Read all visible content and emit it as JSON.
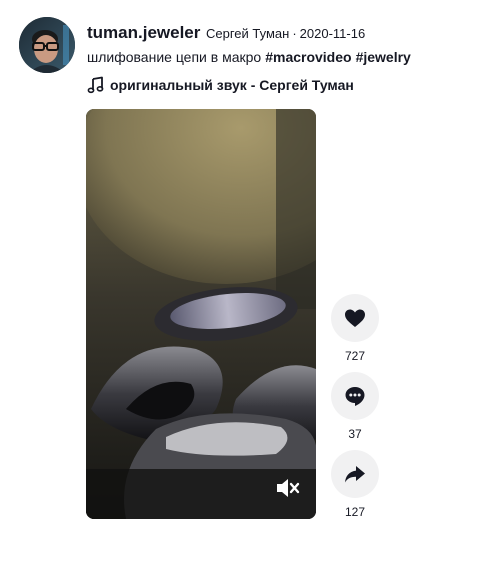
{
  "author": {
    "username": "tuman.jeweler",
    "display_name": "Сергей Туман",
    "separator": "·",
    "date": "2020-11-16"
  },
  "caption": {
    "text": "шлифование цепи в макро",
    "hashtags": [
      "#macrovideo",
      "#jewelry"
    ]
  },
  "music": {
    "title": "оригинальный звук - Сергей Туман",
    "icon": "music-note-icon"
  },
  "video": {
    "muted": true,
    "mute_icon": "volume-muted-icon"
  },
  "actions": {
    "likes": {
      "icon": "heart-icon",
      "count": "727"
    },
    "comments": {
      "icon": "comment-icon",
      "count": "37"
    },
    "shares": {
      "icon": "share-icon",
      "count": "127"
    }
  },
  "colors": {
    "text": "#161823",
    "action_bg": "#f1f1f2"
  }
}
